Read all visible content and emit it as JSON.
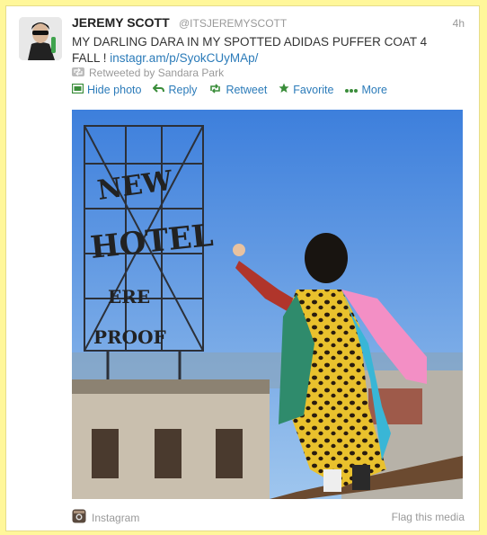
{
  "tweet": {
    "author_name": "JEREMY SCOTT",
    "author_handle": "@ITSJEREMYSCOTT",
    "time": "4h",
    "text_main": "MY DARLING DARA IN MY SPOTTED ADIDAS PUFFER COAT 4 FALL ! ",
    "text_link": "instagr.am/p/SyokCUyMAp/",
    "retweeted_by": "Retweeted by Sandara Park"
  },
  "actions": {
    "hide_photo": "Hide photo",
    "reply": "Reply",
    "retweet": "Retweet",
    "favorite": "Favorite",
    "more": "More"
  },
  "media": {
    "source": "Instagram",
    "flag": "Flag this media",
    "sign_letters": [
      "NEW",
      "HOTEL",
      "ERE",
      "PROOF"
    ]
  },
  "colors": {
    "page_bg": "#fff79a",
    "link": "#2b7bb9",
    "muted": "#999999",
    "sky": "#4f8fe0"
  },
  "icons": [
    "avatar",
    "retweet-small-icon",
    "photo-icon",
    "reply-icon",
    "retweet-icon",
    "favorite-icon",
    "more-icon",
    "instagram-icon"
  ]
}
